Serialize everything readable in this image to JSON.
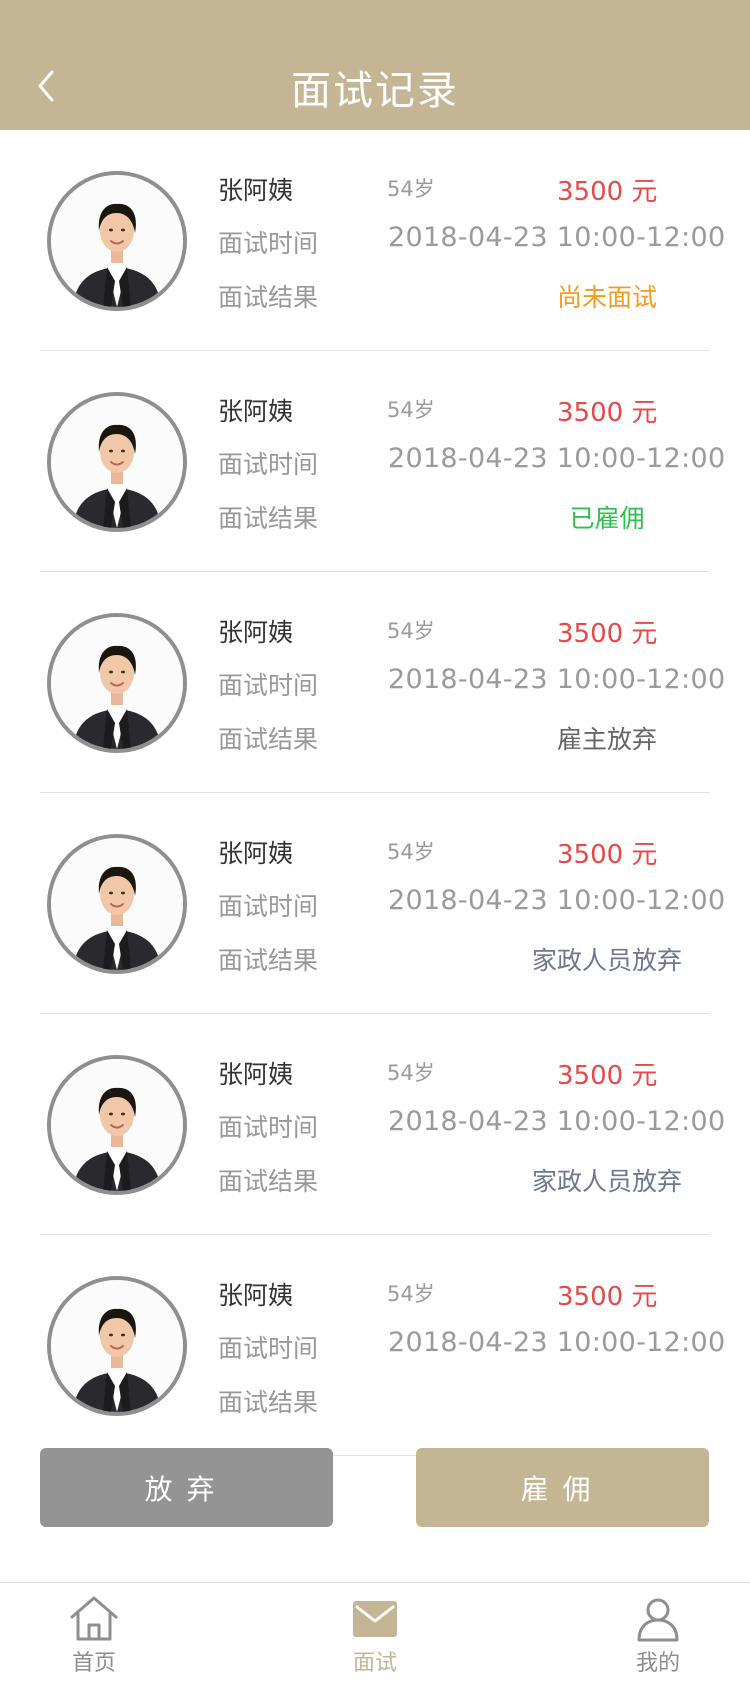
{
  "header": {
    "title": "面试记录"
  },
  "records": [
    {
      "name": "张阿姨",
      "age": "54岁",
      "salary": "3500 元",
      "time_label": "面试时间",
      "time": "2018-04-23 10:00-12:00",
      "result_label": "面试结果",
      "result": "尚未面试",
      "result_color": "#f39c1e"
    },
    {
      "name": "张阿姨",
      "age": "54岁",
      "salary": "3500 元",
      "time_label": "面试时间",
      "time": "2018-04-23 10:00-12:00",
      "result_label": "面试结果",
      "result": "已雇佣",
      "result_color": "#2ec04f"
    },
    {
      "name": "张阿姨",
      "age": "54岁",
      "salary": "3500 元",
      "time_label": "面试时间",
      "time": "2018-04-23 10:00-12:00",
      "result_label": "面试结果",
      "result": "雇主放弃",
      "result_color": "#666666"
    },
    {
      "name": "张阿姨",
      "age": "54岁",
      "salary": "3500 元",
      "time_label": "面试时间",
      "time": "2018-04-23 10:00-12:00",
      "result_label": "面试结果",
      "result": "家政人员放弃",
      "result_color": "#6e7690"
    },
    {
      "name": "张阿姨",
      "age": "54岁",
      "salary": "3500 元",
      "time_label": "面试时间",
      "time": "2018-04-23 10:00-12:00",
      "result_label": "面试结果",
      "result": "家政人员放弃",
      "result_color": "#6e7690"
    },
    {
      "name": "张阿姨",
      "age": "54岁",
      "salary": "3500 元",
      "time_label": "面试时间",
      "time": "2018-04-23 10:00-12:00",
      "result_label": "面试结果",
      "result": "",
      "result_color": "#666666"
    }
  ],
  "actions": {
    "abandon_label": "放弃",
    "hire_label": "雇佣"
  },
  "tabbar": {
    "items": [
      {
        "label": "首页",
        "icon": "home-icon",
        "active": false
      },
      {
        "label": "面试",
        "icon": "envelope-icon",
        "active": true
      },
      {
        "label": "我的",
        "icon": "user-icon",
        "active": false
      }
    ]
  },
  "colors": {
    "brand": "#c4b594",
    "price": "#e84848",
    "inactive_tab": "#8e8e8e",
    "abandon_button": "#949494"
  }
}
